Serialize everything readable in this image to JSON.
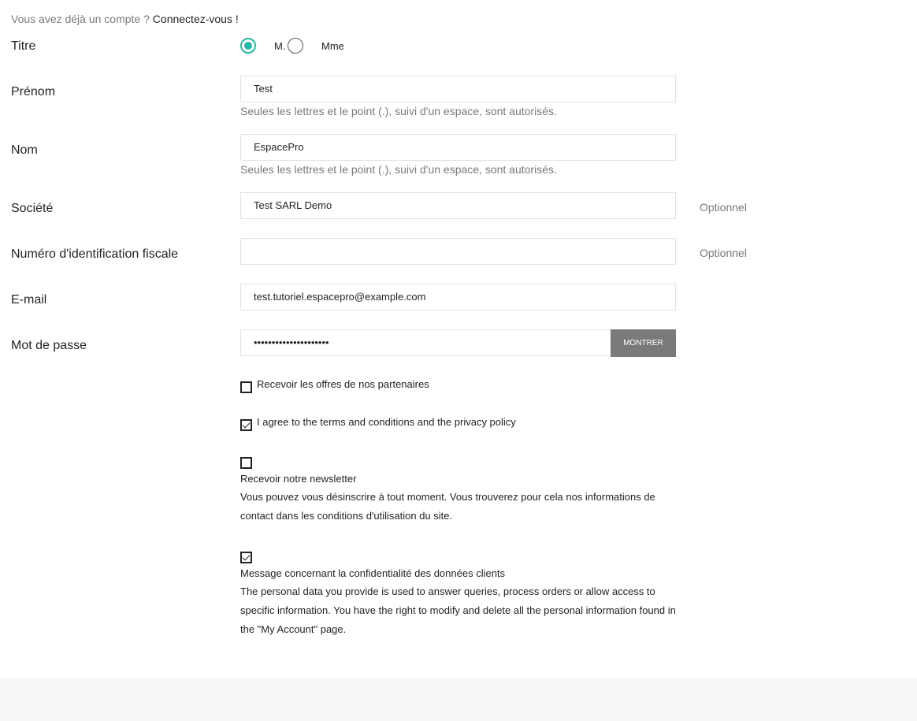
{
  "login": {
    "prefix": "Vous avez déjà un compte ?",
    "link": "Connectez-vous !"
  },
  "title_field": {
    "label": "Titre",
    "options": [
      "M.",
      "Mme"
    ],
    "selected": "M."
  },
  "firstname": {
    "label": "Prénom",
    "value": "Test",
    "hint": "Seules les lettres et le point (.), suivi d'un espace, sont autorisés."
  },
  "lastname": {
    "label": "Nom",
    "value": "EspacePro",
    "hint": "Seules les lettres et le point (.), suivi d'un espace, sont autorisés."
  },
  "company": {
    "label": "Société",
    "value": "Test SARL Demo",
    "optional": "Optionnel"
  },
  "vat": {
    "label": "Numéro d'identification fiscale",
    "value": "",
    "optional": "Optionnel"
  },
  "email": {
    "label": "E-mail",
    "value": "test.tutoriel.espacepro@example.com"
  },
  "password": {
    "label": "Mot de passe",
    "value": "•••••••••••••••••••••",
    "show_button": "MONTRER"
  },
  "optin": {
    "label": "Recevoir les offres de nos partenaires",
    "checked": false
  },
  "terms": {
    "label": "I agree to the terms and conditions and the privacy policy",
    "checked": true
  },
  "newsletter": {
    "label": "Recevoir notre newsletter",
    "desc": "Vous pouvez vous désinscrire à tout moment. Vous trouverez pour cela nos informations de contact dans les conditions d'utilisation du site.",
    "checked": false
  },
  "privacy": {
    "label": "Message concernant la confidentialité des données clients",
    "desc": "The personal data you provide is used to answer queries, process orders or allow access to specific information. You have the right to modify and delete all the personal information found in the \"My Account\" page.",
    "checked": true
  },
  "colors": {
    "accent": "#24b9a6",
    "muted": "#7a7a7a",
    "button": "#7a7a7a"
  }
}
